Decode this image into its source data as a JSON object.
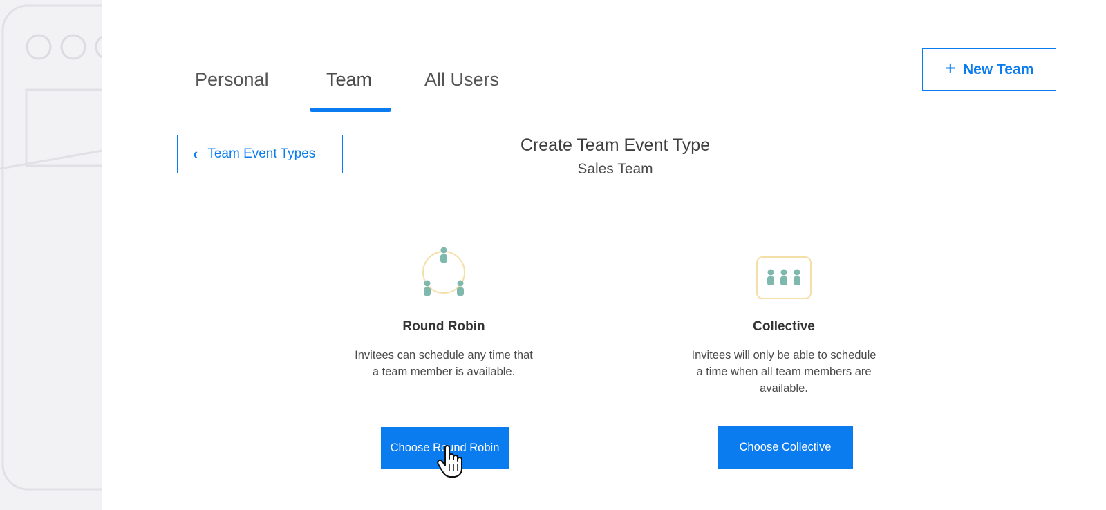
{
  "tabs": [
    {
      "label": "Personal",
      "active": false
    },
    {
      "label": "Team",
      "active": true
    },
    {
      "label": "All Users",
      "active": false
    }
  ],
  "new_team_button": {
    "label": "New Team",
    "icon": "plus-icon"
  },
  "back_button": {
    "label": "Team Event Types",
    "icon": "chevron-left-icon"
  },
  "header": {
    "title": "Create Team Event Type",
    "subtitle": "Sales Team"
  },
  "options": [
    {
      "title": "Round Robin",
      "description": "Invitees can schedule any time that a team member is available.",
      "button_label": "Choose Round Robin",
      "icon": "round-robin-icon"
    },
    {
      "title": "Collective",
      "description": "Invitees will only be able to schedule a time when all team members are available.",
      "button_label": "Choose Collective",
      "icon": "collective-icon"
    }
  ],
  "colors": {
    "accent": "#0a7cf0",
    "icon_teal": "#7fb8ac",
    "icon_yellow": "#f5dfa8"
  },
  "cursor": {
    "icon": "hand-pointer-icon"
  }
}
